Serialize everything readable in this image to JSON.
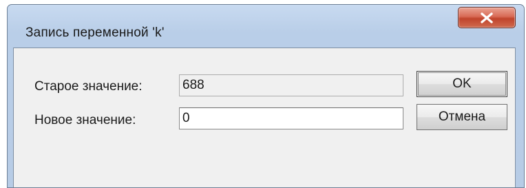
{
  "window": {
    "title": "Запись переменной 'k'",
    "close_icon": "close-icon"
  },
  "form": {
    "old_value_label": "Старое значение:",
    "old_value": "688",
    "new_value_label": "Новое значение:",
    "new_value": "0"
  },
  "buttons": {
    "ok_label": "OK",
    "cancel_label": "Отмена"
  }
}
